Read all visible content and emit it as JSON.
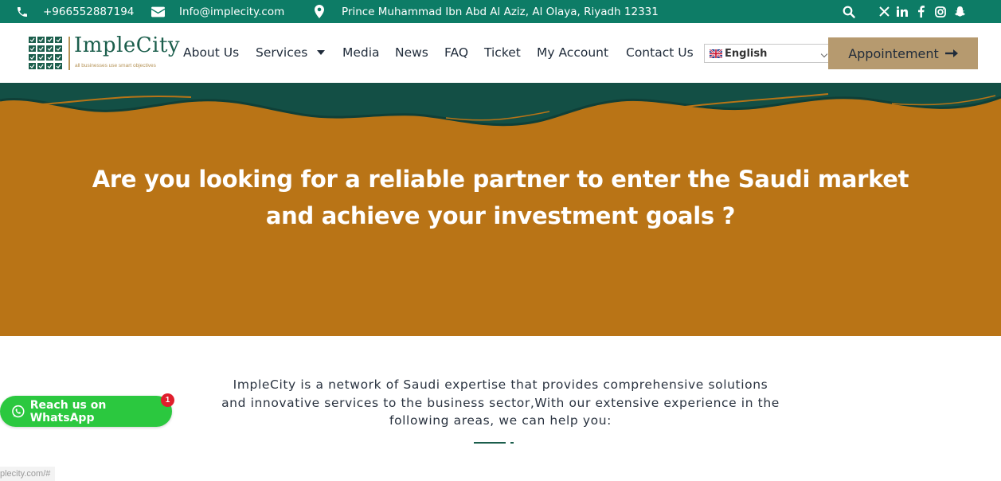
{
  "topbar": {
    "phone": "+966552887194",
    "email": "Info@implecity.com",
    "address": "Prince Muhammad Ibn Abd Al Aziz, Al Olaya, Riyadh 12331",
    "social_icons": [
      "search-icon",
      "x-icon",
      "linkedin-icon",
      "facebook-icon",
      "instagram-icon",
      "snapchat-icon"
    ]
  },
  "logo": {
    "name": "ImpleCity",
    "tagline": "all businesses use smart objectives"
  },
  "nav": {
    "items": [
      "About Us",
      "Services",
      "Media",
      "News",
      "FAQ",
      "Ticket",
      "My Account",
      "Contact Us"
    ]
  },
  "language": {
    "selected": "English"
  },
  "appointment_label": "Appointement",
  "hero": {
    "line1": "Are you looking for a reliable partner to enter the Saudi market",
    "line2": "and achieve your investment goals ?"
  },
  "intro": {
    "line1": "ImpleCity is a network of Saudi expertise that provides comprehensive solutions",
    "line2": "and innovative services to the business sector,With our extensive experience in the",
    "line3": "following areas, we can help you:"
  },
  "whatsapp": {
    "label": "Reach us on WhatsApp",
    "badge": "1"
  },
  "status_url": "plecity.com/#",
  "colors": {
    "topbar": "#0d7c66",
    "hero": "#b97416",
    "wave_dark": "#134f45",
    "button": "#b69a6f",
    "whatsapp": "#2bc83f"
  }
}
